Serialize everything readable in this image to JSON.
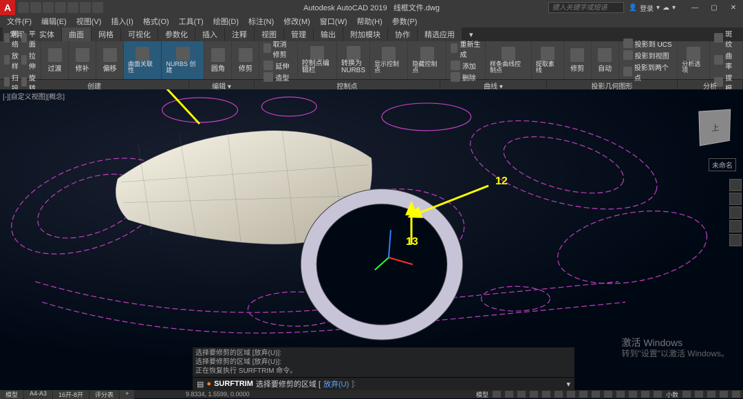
{
  "title_bar": {
    "app_name": "Autodesk AutoCAD 2019",
    "file_name": "线框文件.dwg",
    "search_placeholder": "键入关键字或短语",
    "login_label": "登录"
  },
  "menu": [
    "文件(F)",
    "编辑(E)",
    "视图(V)",
    "插入(I)",
    "格式(O)",
    "工具(T)",
    "绘图(D)",
    "标注(N)",
    "修改(M)",
    "窗口(W)",
    "帮助(H)",
    "参数(P)"
  ],
  "tabs": [
    "常用",
    "实体",
    "曲面",
    "网格",
    "可视化",
    "参数化",
    "插入",
    "注释",
    "视图",
    "管理",
    "输出",
    "附加模块",
    "协作",
    "精选应用"
  ],
  "active_tab": "曲面",
  "ribbon": {
    "group_create": {
      "items": [
        "网络",
        "平面",
        "放样",
        "拉伸",
        "扫掠",
        "旋转"
      ],
      "extra": [
        "过渡",
        "修补",
        "偏移"
      ],
      "highlighted1": "曲面关联性",
      "highlighted2": "NURBS 创建"
    },
    "group_edit": {
      "items": [
        "圆角",
        "修剪"
      ],
      "sub": [
        "取消修剪",
        "延伸",
        "造型"
      ]
    },
    "group_cv": {
      "main": "控制点编辑栏"
    },
    "group_convert": {
      "main": "转换为NURBS"
    },
    "group_cvpts": {
      "items": [
        "显示控制点",
        "隐藏控制点"
      ],
      "sub": [
        "重新生成",
        "添加",
        "删除"
      ]
    },
    "group_spline": {
      "main": "样条曲线控制点",
      "sub": [
        "提取素线",
        "修剪"
      ]
    },
    "group_auto": {
      "main": "自动"
    },
    "group_project": {
      "items": [
        "投影到 UCS",
        "投影到视图",
        "投影到两个点"
      ]
    },
    "group_analysis": {
      "items": [
        "分析选项"
      ],
      "sub": [
        "斑纹",
        "曲率",
        "拔模"
      ]
    }
  },
  "panel_labels": [
    "创建",
    "编辑 ▾",
    "控制点",
    "曲线 ▾",
    "投影几何图形",
    "分析"
  ],
  "panel_widths": [
    275,
    95,
    270,
    155,
    190,
    95
  ],
  "viewport": {
    "label": "[-][自定义视图][概念]",
    "cube_face": "上",
    "unnamed_label": "未命名",
    "annotations": {
      "a1": "12",
      "a2": "13"
    }
  },
  "cmd_history": [
    "选择要修剪的区域 [放弃(U)]:",
    "选择要修剪的区域 [放弃(U)]:",
    "正在恢复执行 SURFTRIM 命令。"
  ],
  "cmd_line": {
    "dot": "●",
    "cmd": "SURFTRIM",
    "prompt": "选择要修剪的区域 [",
    "opt": "放弃(U)",
    "end": "]:"
  },
  "watermark": {
    "l1": "激活 Windows",
    "l2": "转到\"设置\"以激活 Windows。"
  },
  "status": {
    "left": [
      "模型",
      "A4-A3",
      "16开-8开",
      "评分表",
      "+"
    ],
    "coords": "9.8334, 1.5599, 0.0000",
    "right_text": [
      "模型",
      "小数"
    ]
  }
}
